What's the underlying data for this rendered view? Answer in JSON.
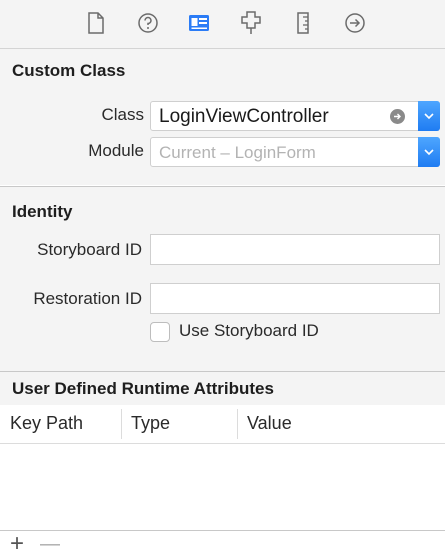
{
  "toolbar": {
    "icons": [
      "file-inspector-icon",
      "quick-help-icon",
      "identity-inspector-icon",
      "attributes-inspector-icon",
      "size-inspector-icon",
      "connections-inspector-icon"
    ],
    "selected_icon": "identity-inspector-icon",
    "accent": "#2b7cf6"
  },
  "custom_class": {
    "title": "Custom Class",
    "class_label": "Class",
    "class_value": "LoginViewController",
    "module_label": "Module",
    "module_placeholder": "Current – LoginForm"
  },
  "identity": {
    "title": "Identity",
    "storyboard_id_label": "Storyboard ID",
    "storyboard_id_value": "",
    "restoration_id_label": "Restoration ID",
    "restoration_id_value": "",
    "use_storyboard_id_label": "Use Storyboard ID",
    "use_storyboard_id_checked": false
  },
  "udra": {
    "title": "User Defined Runtime Attributes",
    "columns": [
      "Key Path",
      "Type",
      "Value"
    ]
  },
  "bottom_bar": {
    "add_label": "+",
    "remove_label": "—"
  }
}
